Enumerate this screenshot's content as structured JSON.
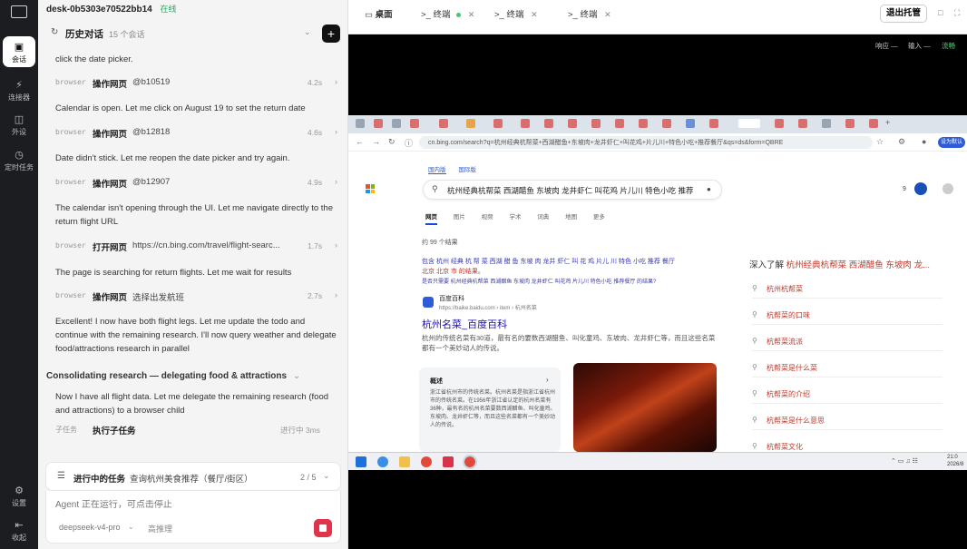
{
  "rail": {
    "items": [
      {
        "label": "会话",
        "icon": "chat-icon"
      },
      {
        "label": "连接器",
        "icon": "plug-icon"
      },
      {
        "label": "外设",
        "icon": "devices-icon"
      },
      {
        "label": "定时任务",
        "icon": "clock-icon"
      },
      {
        "label": "设置",
        "icon": "gear-icon"
      },
      {
        "label": "收起",
        "icon": "collapse-icon"
      }
    ]
  },
  "panel": {
    "session_name": "desk-0b5303e70522bb14",
    "status": "在线",
    "history_title": "历史对话",
    "history_count": "15 个会话"
  },
  "log": [
    {
      "kind": "msg",
      "text": "click the date picker."
    },
    {
      "kind": "step",
      "src": "browser",
      "action": "操作网页",
      "arg": "@b10519",
      "time": "4.2s"
    },
    {
      "kind": "msg",
      "text": "Calendar is open. Let me click on August 19 to set the return date"
    },
    {
      "kind": "step",
      "src": "browser",
      "action": "操作网页",
      "arg": "@b12818",
      "time": "4.6s"
    },
    {
      "kind": "msg",
      "text": "Date didn't stick. Let me reopen the date picker and try again."
    },
    {
      "kind": "step",
      "src": "browser",
      "action": "操作网页",
      "arg": "@b12907",
      "time": "4.9s"
    },
    {
      "kind": "msg",
      "text": "The calendar isn't opening through the UI. Let me navigate directly to the return flight URL"
    },
    {
      "kind": "step",
      "src": "browser",
      "action": "打开网页",
      "arg": "https://cn.bing.com/travel/flight-searc...",
      "time": "1.7s"
    },
    {
      "kind": "msg",
      "text": "The page is searching for return flights. Let me wait for results"
    },
    {
      "kind": "step",
      "src": "browser",
      "action": "操作网页",
      "arg": "选择出发航班",
      "time": "2.7s"
    },
    {
      "kind": "msg",
      "text": "Excellent! I now have both flight legs. Let me update the todo and continue with the remaining research. I'll now query weather and delegate food/attractions research in parallel"
    },
    {
      "kind": "section",
      "text": "Consolidating research — delegating food & attractions"
    },
    {
      "kind": "msg",
      "text": "Now I have all flight data. Let me delegate the remaining research (food and attractions) to a browser child"
    },
    {
      "kind": "step",
      "src": "子任务",
      "action": "执行子任务",
      "arg": "",
      "time": "进行中 3ms"
    }
  ],
  "task": {
    "label": "进行中的任务",
    "value": "查询杭州美食推荐（餐厅/街区）",
    "progress": "2 / 5"
  },
  "composer": {
    "placeholder": "Agent 正在运行，可点击停止",
    "model": "deepseek-v4-pro",
    "mode": "高推理"
  },
  "window_tabs": [
    {
      "label": "桌面",
      "icon": "monitor-icon",
      "dot": false,
      "close": false
    },
    {
      "label": "终端",
      "icon": "terminal-icon",
      "dot": true,
      "close": true
    },
    {
      "label": "终端",
      "icon": "terminal-icon",
      "dot": false,
      "close": true
    },
    {
      "label": "终端",
      "icon": "terminal-icon",
      "dot": false,
      "close": true
    }
  ],
  "topbar": {
    "exit_label": "退出托管"
  },
  "remote_status": {
    "a": "响应 —",
    "b": "输入 —",
    "c": "流畅"
  },
  "browser": {
    "url": "cn.bing.com/search?q=杭州经典杭帮菜+西湖醋鱼+东坡肉+龙井虾仁+叫花鸡+片儿川+特色小吃+推荐餐厅&qs=ds&form=QBRE",
    "btn": "设为默认",
    "scopes": [
      "国内版",
      "国际版"
    ],
    "query": "杭州经典杭帮菜 西湖醋鱼 东坡肉 龙井虾仁 叫花鸡 片儿川 特色小吃 推荐",
    "tabs": [
      "网页",
      "图片",
      "视频",
      "学术",
      "词典",
      "地图",
      "更多"
    ],
    "result_count": "约 99 个结果",
    "contains": "包含 杭州 经典 杭 帮 菜 西湖 醋 鱼 东坡 肉 龙井 虾仁 叫 花 鸡 片儿 川 特色 小吃 推荐 餐厅",
    "contains2": "北京 北京 市 的结果。",
    "suggest": "是否只需要 杭州经典杭帮菜 西湖醋鱼 东坡肉 龙井虾仁 叫花鸡 片儿川 特色小吃 推荐餐厅 的结果?",
    "site_name": "百度百科",
    "site_url": "https://baike.baidu.com › item › 杭州名菜",
    "title": "杭州名菜_百度百科",
    "snippet": "杭州的传统名菜有30道，最有名的要数西湖醋鱼、叫化童鸡、东坡肉、龙井虾仁等，而且这些名菜都有一个美妙动人的传说。",
    "box_title": "概述",
    "box_text": "浙江省杭州市的传统名菜。杭州名菜是指浙江省杭州市的传统名菜。在1956年浙江省认定的杭州名菜有36种，最有名的杭州名菜要数西湖醋鱼、叫化童鸡、东坡肉、龙井虾仁等，而且这些名菜都有一个美妙动人的传说。",
    "side_title": "深入了解",
    "side_title_hl": "杭州经典杭帮菜 西湖醋鱼 东坡肉 龙...",
    "related": [
      "杭州杭帮菜",
      "杭帮菜的口味",
      "杭帮菜流派",
      "杭帮菜是什么菜",
      "杭帮菜的介绍",
      "杭帮菜是什么意思",
      "杭帮菜文化"
    ]
  },
  "clock": {
    "time": "21:0",
    "date": "2026/8"
  }
}
